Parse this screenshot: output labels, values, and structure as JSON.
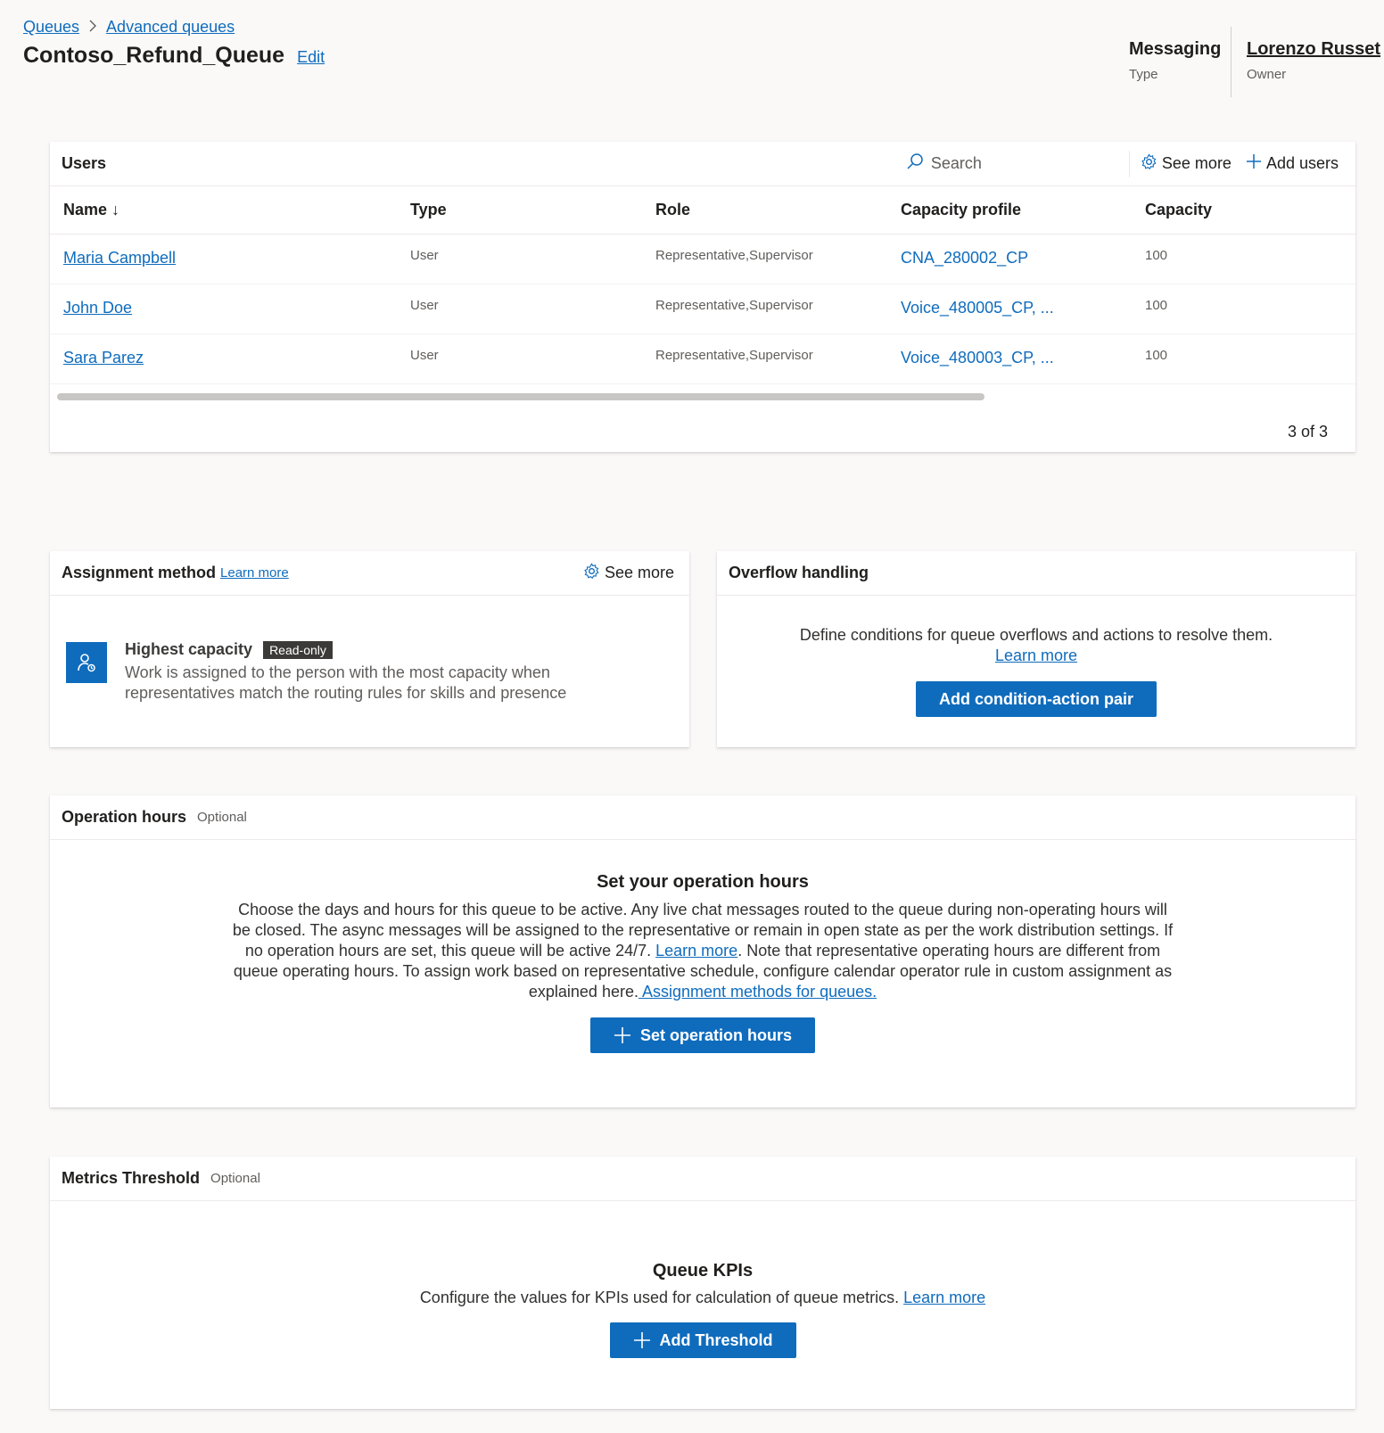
{
  "breadcrumb": {
    "root": "Queues",
    "current": "Advanced queues"
  },
  "page": {
    "title": "Contoso_Refund_Queue",
    "edit_label": "Edit"
  },
  "meta": {
    "type_value": "Messaging",
    "type_label": "Type",
    "owner_value": "Lorenzo Russet",
    "owner_label": "Owner"
  },
  "users": {
    "header": "Users",
    "search_placeholder": "Search",
    "see_more": "See more",
    "add_users": "Add users",
    "columns": [
      "Name ↓",
      "Type",
      "Role",
      "Capacity profile",
      "Capacity"
    ],
    "rows": [
      {
        "name": "Maria Campbell",
        "type": "User",
        "role": "Representative,Supervisor",
        "capacity_profile": "CNA_280002_CP",
        "capacity": "100"
      },
      {
        "name": "John Doe",
        "type": "User",
        "role": "Representative,Supervisor",
        "capacity_profile": "Voice_480005_CP, ...",
        "capacity": "100"
      },
      {
        "name": "Sara Parez",
        "type": "User",
        "role": "Representative,Supervisor",
        "capacity_profile": "Voice_480003_CP, ...",
        "capacity": "100"
      }
    ],
    "pager": "3 of 3"
  },
  "assignment": {
    "header": "Assignment method",
    "learn_more": "Learn more",
    "see_more": "See more",
    "method_title": "Highest capacity",
    "badge": "Read-only",
    "method_desc": "Work is assigned to the person with the most capacity when representatives match the routing rules for skills and presence"
  },
  "overflow": {
    "header": "Overflow handling",
    "desc": "Define conditions for queue overflows and actions to resolve them.",
    "learn_more": "Learn more",
    "button": "Add condition-action pair"
  },
  "operation_hours": {
    "header": "Operation hours",
    "optional": "Optional",
    "title": "Set your operation hours",
    "desc_part1": "Choose the days and hours for this queue to be active. Any live chat messages routed to the queue during non-operating hours will be closed. The async messages will be assigned to the representative or remain in open state as per the work distribution settings. If no operation hours are set, this queue will be active 24/7. ",
    "learn_more": "Learn more",
    "desc_part2": ". Note that representative operating hours are different from queue operating hours. To assign work based on representative schedule, configure calendar operator rule in custom assignment as explained here.",
    "assignment_link": " Assignment methods for queues.",
    "button": "Set operation hours"
  },
  "metrics": {
    "header": "Metrics Threshold",
    "optional": "Optional",
    "title": "Queue KPIs",
    "desc": "Configure the values for KPIs used for calculation of queue metrics. ",
    "learn_more": "Learn more",
    "button": "Add Threshold"
  },
  "colors": {
    "accent": "#0f6cbd",
    "background": "#faf9f8",
    "badge": "#3b3a39"
  }
}
